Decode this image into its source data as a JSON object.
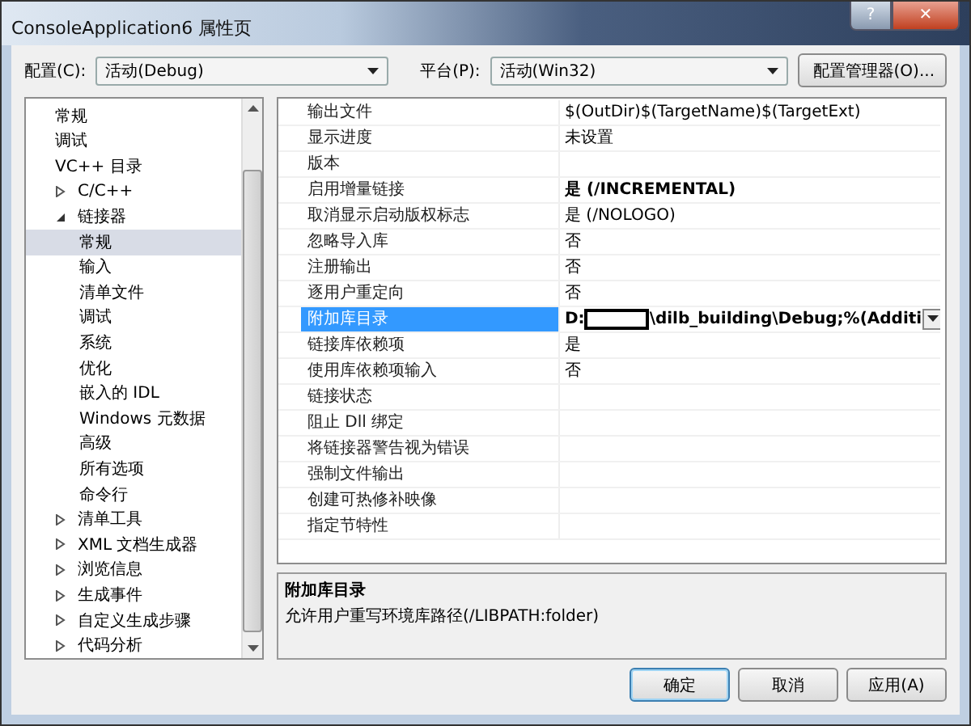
{
  "window": {
    "title": "ConsoleApplication6 属性页",
    "buttons": [
      "?",
      "✕"
    ]
  },
  "toolbar": {
    "config_label": "配置(C):",
    "config_value": "活动(Debug)",
    "platform_label": "平台(P):",
    "platform_value": "活动(Win32)",
    "manager_button": "配置管理器(O)..."
  },
  "tree": [
    {
      "label": "常规",
      "selected": false
    },
    {
      "label": "调试",
      "selected": false
    },
    {
      "label": "VC++ 目录",
      "selected": false
    },
    {
      "label": "C/C++",
      "selected": false,
      "expanded": false
    },
    {
      "label": "链接器",
      "selected": false,
      "expanded": true,
      "children": [
        {
          "label": "常规",
          "selected": true
        },
        {
          "label": "输入",
          "selected": false
        },
        {
          "label": "清单文件",
          "selected": false
        },
        {
          "label": "调试",
          "selected": false
        },
        {
          "label": "系统",
          "selected": false
        },
        {
          "label": "优化",
          "selected": false
        },
        {
          "label": "嵌入的 IDL",
          "selected": false
        },
        {
          "label": "Windows 元数据",
          "selected": false
        },
        {
          "label": "高级",
          "selected": false
        },
        {
          "label": "所有选项",
          "selected": false
        },
        {
          "label": "命令行",
          "selected": false
        }
      ]
    },
    {
      "label": "清单工具",
      "selected": false,
      "expanded": false
    },
    {
      "label": "XML 文档生成器",
      "selected": false,
      "expanded": false
    },
    {
      "label": "浏览信息",
      "selected": false,
      "expanded": false
    },
    {
      "label": "生成事件",
      "selected": false,
      "expanded": false
    },
    {
      "label": "自定义生成步骤",
      "selected": false,
      "expanded": false
    },
    {
      "label": "代码分析",
      "selected": false,
      "expanded": false
    }
  ],
  "properties": [
    {
      "name": "输出文件",
      "value": "$(OutDir)$(TargetName)$(TargetExt)",
      "bold": false,
      "selected": false
    },
    {
      "name": "显示进度",
      "value": "未设置",
      "bold": false,
      "selected": false
    },
    {
      "name": "版本",
      "bold": false,
      "selected": false
    },
    {
      "name": "启用增量链接",
      "value": "是 (/INCREMENTAL)",
      "bold": true,
      "selected": false
    },
    {
      "name": "取消显示启动版权标志",
      "value": "是 (/NOLOGO)",
      "bold": false,
      "selected": false
    },
    {
      "name": "忽略导入库",
      "value": "否",
      "bold": false,
      "selected": false
    },
    {
      "name": "注册输出",
      "value": "否",
      "bold": false,
      "selected": false
    },
    {
      "name": "逐用户重定向",
      "value": "否",
      "bold": false,
      "selected": false
    },
    {
      "name": "附加库目录",
      "value": "D:",
      "value_after_redaction": "\\dilb_building\\Debug;%(Additi",
      "bold": true,
      "selected": true
    },
    {
      "name": "链接库依赖项",
      "value": "是",
      "bold": false,
      "selected": false
    },
    {
      "name": "使用库依赖项输入",
      "value": "否",
      "bold": false,
      "selected": false
    },
    {
      "name": "链接状态",
      "bold": false,
      "selected": false
    },
    {
      "name": "阻止 Dll 绑定",
      "bold": false,
      "selected": false
    },
    {
      "name": "将链接器警告视为错误",
      "bold": false,
      "selected": false
    },
    {
      "name": "强制文件输出",
      "bold": false,
      "selected": false
    },
    {
      "name": "创建可热修补映像",
      "bold": false,
      "selected": false
    },
    {
      "name": "指定节特性",
      "bold": false,
      "selected": false
    }
  ],
  "description": {
    "title": "附加库目录",
    "text": "允许用户重写环境库路径(/LIBPATH:folder)"
  },
  "buttons": [
    {
      "label": "确定",
      "default": true
    },
    {
      "label": "取消",
      "default": false
    },
    {
      "label": "应用(A)",
      "default": false
    }
  ]
}
